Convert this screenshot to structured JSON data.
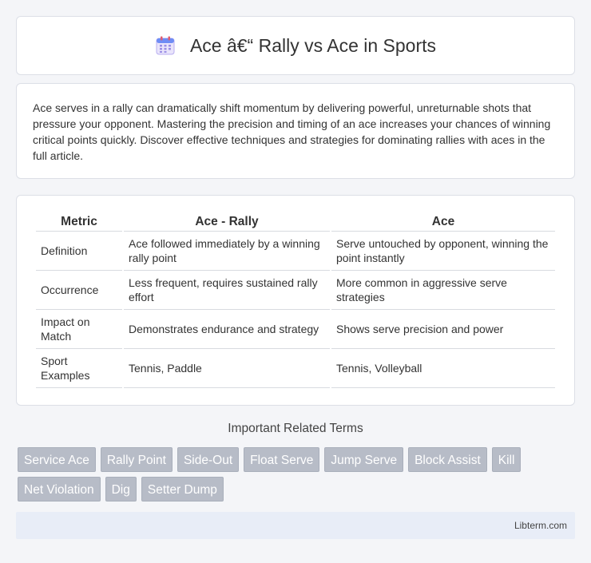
{
  "header": {
    "title": "Ace â€“ Rally vs Ace in Sports",
    "icon": "calendar-icon"
  },
  "intro": {
    "text": "Ace serves in a rally can dramatically shift momentum by delivering powerful, unreturnable shots that pressure your opponent. Mastering the precision and timing of an ace increases your chances of winning critical points quickly. Discover effective techniques and strategies for dominating rallies with aces in the full article."
  },
  "table": {
    "headers": [
      "Metric",
      "Ace - Rally",
      "Ace"
    ],
    "rows": [
      [
        "Definition",
        "Ace followed immediately by a winning rally point",
        "Serve untouched by opponent, winning the point instantly"
      ],
      [
        "Occurrence",
        "Less frequent, requires sustained rally effort",
        "More common in aggressive serve strategies"
      ],
      [
        "Impact on Match",
        "Demonstrates endurance and strategy",
        "Shows serve precision and power"
      ],
      [
        "Sport Examples",
        "Tennis, Paddle",
        "Tennis, Volleyball"
      ]
    ]
  },
  "related": {
    "title": "Important Related Terms",
    "tags": [
      "Service Ace",
      "Rally Point",
      "Side-Out",
      "Float Serve",
      "Jump Serve",
      "Block Assist",
      "Kill",
      "Net Violation",
      "Dig",
      "Setter Dump"
    ]
  },
  "footer": {
    "text": "Libterm.com"
  },
  "colors": {
    "tag_bg": "#b7bcc7",
    "footer_bg": "#e8edf7"
  }
}
